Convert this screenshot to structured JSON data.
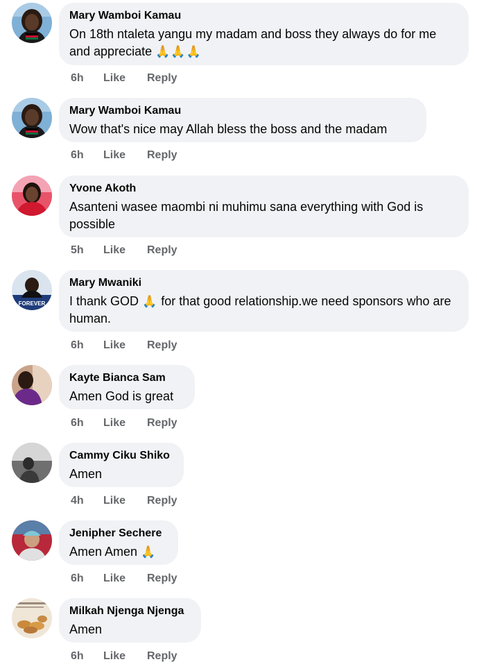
{
  "comments": [
    {
      "author": "Mary Wamboi Kamau",
      "text": "On 18th ntaleta yangu my madam and boss they always do for me and appreciate",
      "emoji": "🙏🙏🙏",
      "time": "6h",
      "like_label": "Like",
      "reply_label": "Reply",
      "avatar_icon": "profile-photo-woman-flag"
    },
    {
      "author": "Mary Wamboi Kamau",
      "text": "Wow that's nice may Allah bless the boss and the madam",
      "emoji": "",
      "time": "6h",
      "like_label": "Like",
      "reply_label": "Reply",
      "avatar_icon": "profile-photo-woman-flag"
    },
    {
      "author": "Yvone Akoth",
      "text": "Asanteni wasee maombi ni muhimu sana everything with God is possible",
      "emoji": "",
      "time": "5h",
      "like_label": "Like",
      "reply_label": "Reply",
      "avatar_icon": "profile-photo-woman-red"
    },
    {
      "author": "Mary Mwaniki",
      "text": "I thank GOD",
      "emoji": "🙏",
      "text_after": "for that good relationship.we need sponsors who are human.",
      "time": "6h",
      "like_label": "Like",
      "reply_label": "Reply",
      "avatar_icon": "profile-photo-forever-badge",
      "avatar_caption": "FOREVER"
    },
    {
      "author": "Kayte Bianca Sam",
      "text": "Amen God is great",
      "emoji": "",
      "time": "6h",
      "like_label": "Like",
      "reply_label": "Reply",
      "avatar_icon": "profile-photo-purple-wall"
    },
    {
      "author": "Cammy Ciku Shiko",
      "text": "Amen",
      "emoji": "",
      "time": "4h",
      "like_label": "Like",
      "reply_label": "Reply",
      "avatar_icon": "profile-photo-grayscale"
    },
    {
      "author": "Jenipher Sechere",
      "text": "Amen Amen",
      "emoji": "🙏",
      "time": "6h",
      "like_label": "Like",
      "reply_label": "Reply",
      "avatar_icon": "profile-photo-child-red"
    },
    {
      "author": "Milkah Njenga Njenga",
      "text": "Amen",
      "emoji": "",
      "time": "6h",
      "like_label": "Like",
      "reply_label": "Reply",
      "avatar_icon": "profile-photo-food-plate"
    }
  ],
  "colors": {
    "bubble": "#f0f2f5",
    "meta_text": "#65676b",
    "body_text": "#050505",
    "emoji": "#f2b51d"
  }
}
